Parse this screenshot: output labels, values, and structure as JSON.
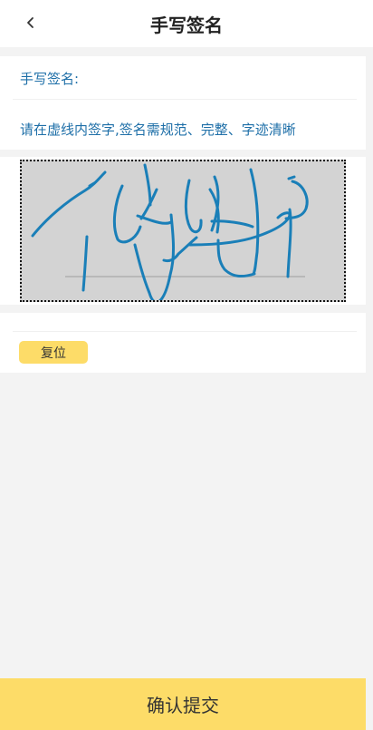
{
  "header": {
    "title": "手写签名",
    "back_icon": "chevron-left-icon"
  },
  "form": {
    "signature_label": "手写签名:",
    "instruction": "请在虚线内签字,签名需规范、完整、字迹清晰"
  },
  "signature_pad": {
    "background_color": "#d3d3d3",
    "stroke_color": "#1a7fb8",
    "has_signature": true
  },
  "actions": {
    "reset_label": "复位",
    "submit_label": "确认提交"
  },
  "colors": {
    "accent": "#fddc68",
    "label_text": "#1e6fa8"
  }
}
